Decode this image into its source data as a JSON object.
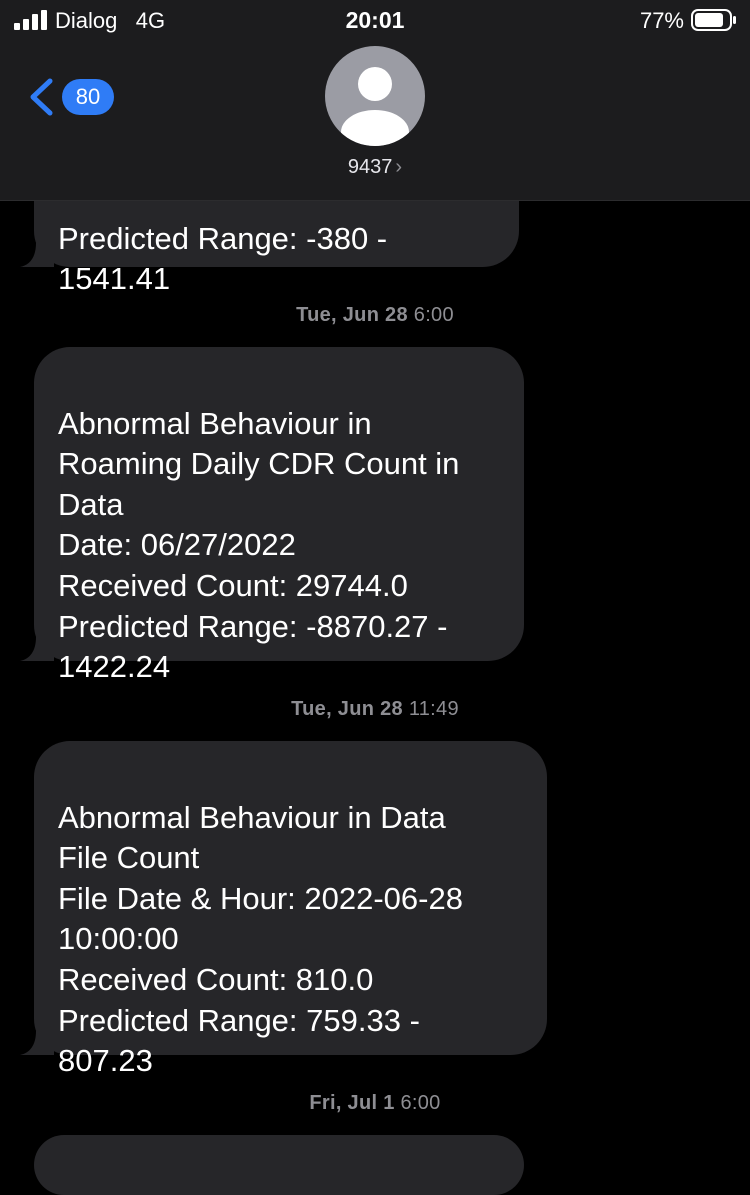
{
  "status_bar": {
    "carrier": "Dialog",
    "network": "4G",
    "time": "20:01",
    "battery_percent": "77%"
  },
  "header": {
    "back_count": "80",
    "contact_name": "9437",
    "chevron": "›"
  },
  "messages": [
    {
      "text": "Predicted Range: -380 -\n1541.41"
    },
    {
      "timestamp_day": "Tue, Jun 28",
      "timestamp_time": "6:00",
      "text": "Abnormal Behaviour in\nRoaming Daily CDR Count in\nData\nDate: 06/27/2022\nReceived Count: 29744.0\nPredicted Range: -8870.27 -\n1422.24"
    },
    {
      "timestamp_day": "Tue, Jun 28",
      "timestamp_time": "11:49",
      "text": "Abnormal Behaviour in Data\nFile Count\nFile Date & Hour: 2022-06-28\n10:00:00\nReceived Count: 810.0\nPredicted Range: 759.33 -\n807.23"
    },
    {
      "timestamp_day": "Fri, Jul 1",
      "timestamp_time": "6:00"
    }
  ],
  "icons": [
    "signal-icon",
    "battery-icon",
    "back-chevron-icon",
    "avatar-icon"
  ],
  "colors": {
    "bubble": "#262629",
    "accent": "#2f7cf6",
    "header": "#1c1c1e",
    "timestamp": "#8e8e93"
  }
}
